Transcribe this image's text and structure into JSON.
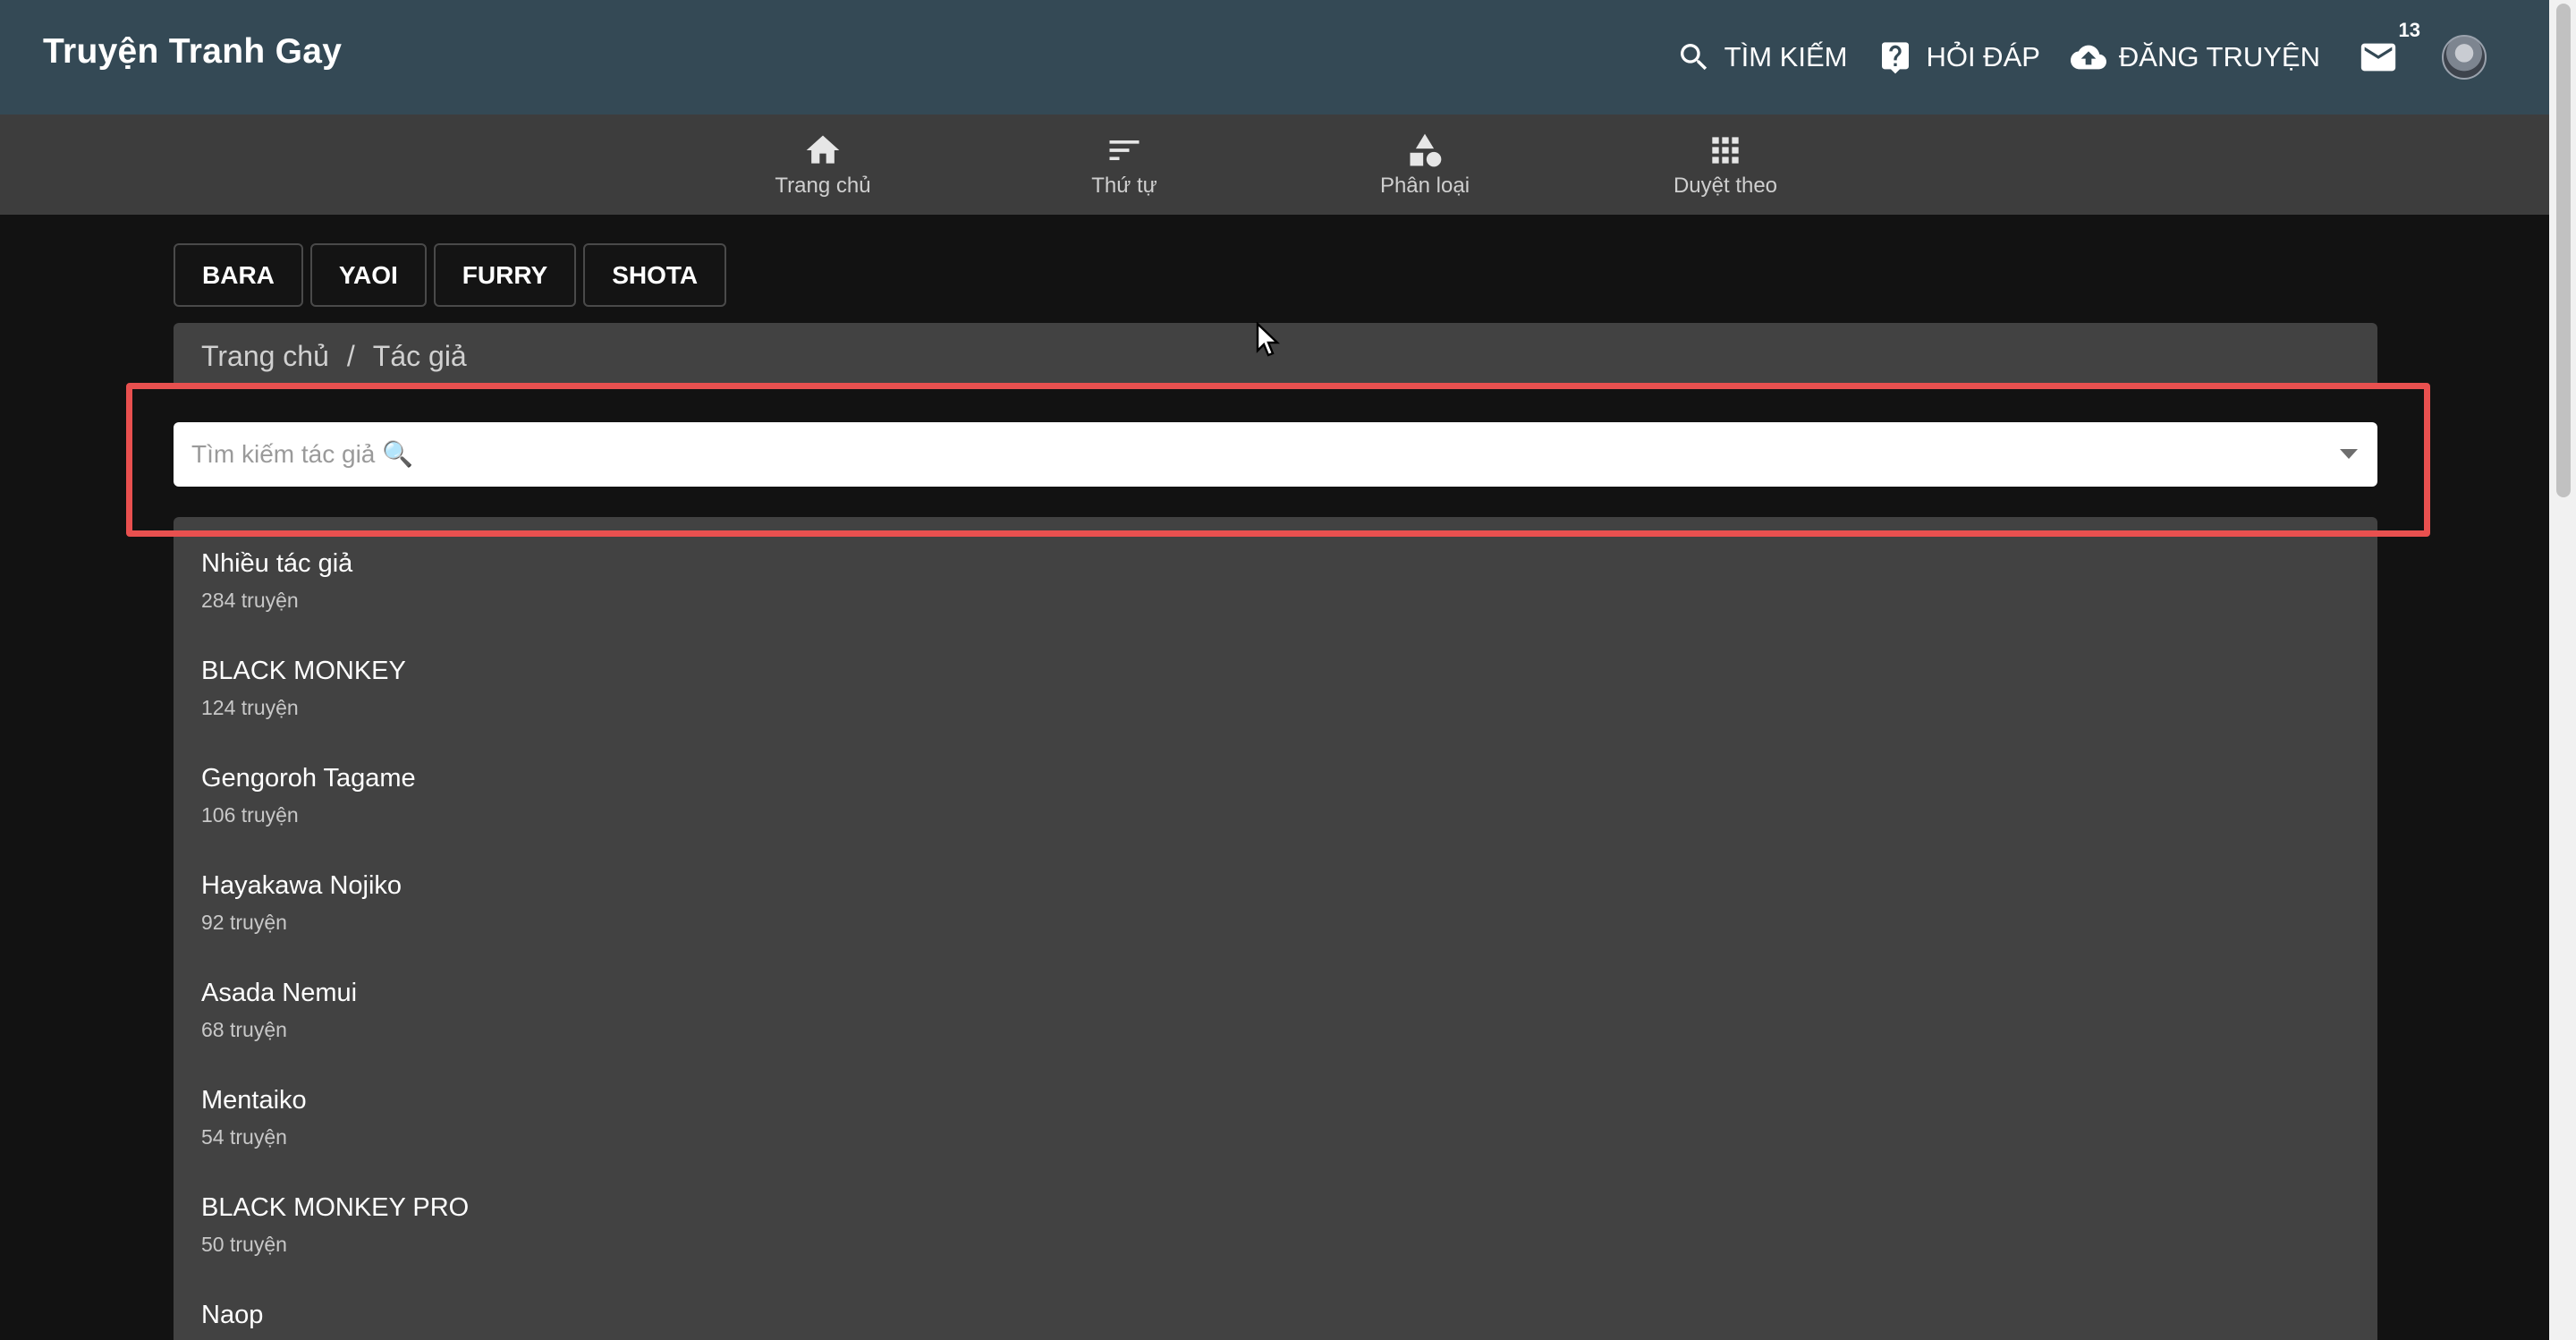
{
  "header": {
    "brand": "Truyện Tranh Gay",
    "actions": [
      {
        "icon": "search-icon",
        "label": "TÌM KIẾM"
      },
      {
        "icon": "question-icon",
        "label": "HỎI ĐÁP"
      },
      {
        "icon": "cloud-upload-icon",
        "label": "ĐĂNG TRUYỆN"
      }
    ],
    "mail_icon": "mail-icon",
    "mail_count": "13"
  },
  "nav": {
    "items": [
      {
        "icon": "home-icon",
        "label": "Trang chủ"
      },
      {
        "icon": "sort-icon",
        "label": "Thứ tự"
      },
      {
        "icon": "category-icon",
        "label": "Phân loại"
      },
      {
        "icon": "apps-grid-icon",
        "label": "Duyệt theo"
      }
    ]
  },
  "tags": [
    "BARA",
    "YAOI",
    "FURRY",
    "SHOTA"
  ],
  "breadcrumb": {
    "home": "Trang chủ",
    "separator": "/",
    "current": "Tác giả"
  },
  "search": {
    "placeholder": "Tìm kiếm tác giả 🔍",
    "value": ""
  },
  "authors": [
    {
      "name": "Nhiều tác giả",
      "count": "284 truyện"
    },
    {
      "name": "BLACK MONKEY",
      "count": "124 truyện"
    },
    {
      "name": "Gengoroh Tagame",
      "count": "106 truyện"
    },
    {
      "name": "Hayakawa Nojiko",
      "count": "92 truyện"
    },
    {
      "name": "Asada Nemui",
      "count": "68 truyện"
    },
    {
      "name": "Mentaiko",
      "count": "54 truyện"
    },
    {
      "name": "BLACK MONKEY PRO",
      "count": "50 truyện"
    },
    {
      "name": "Naop",
      "count": ""
    }
  ],
  "colors": {
    "appbar": "#344955",
    "subnav": "#3d3d3d",
    "background": "#121212",
    "panel": "#424242",
    "highlight": "#e8504f"
  }
}
